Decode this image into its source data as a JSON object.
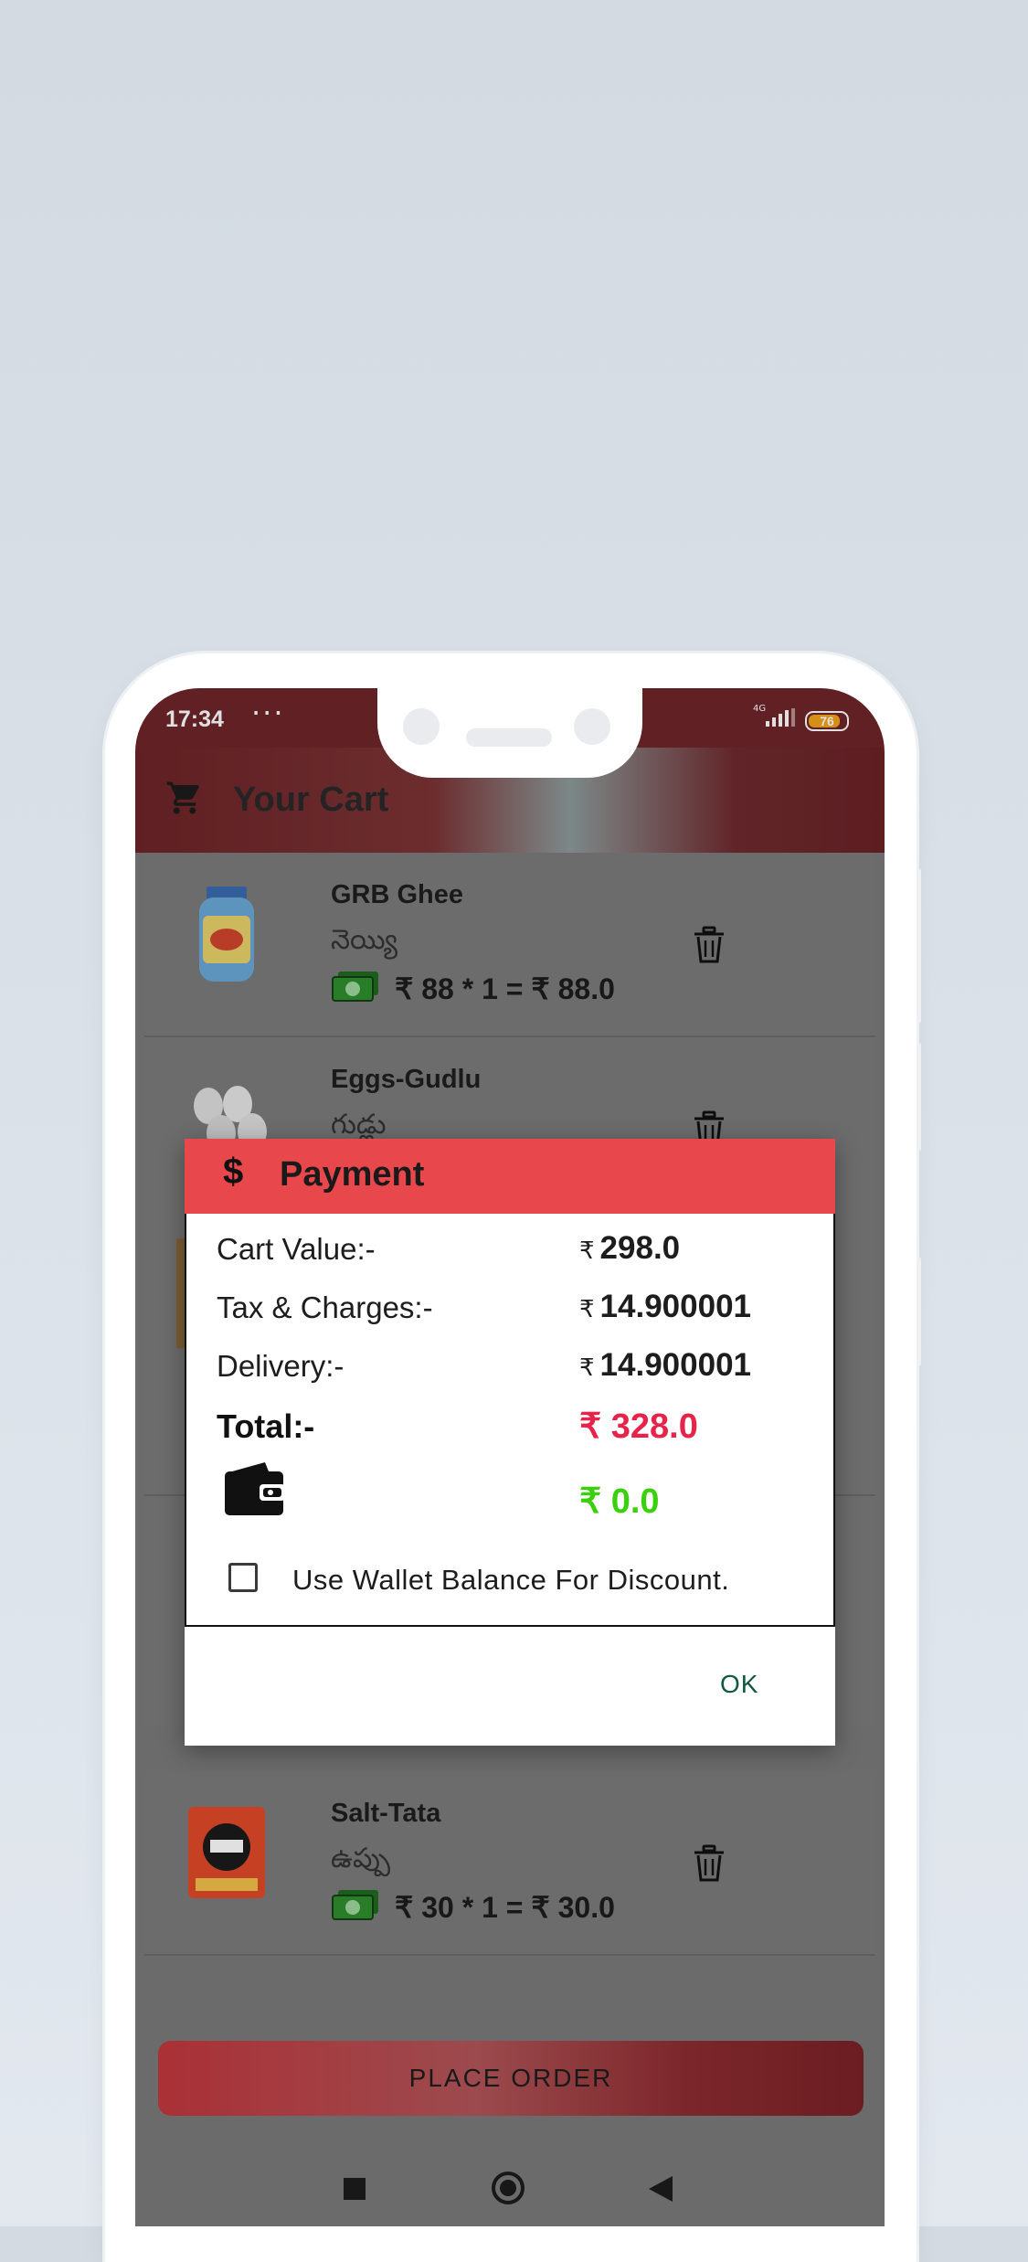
{
  "status_bar": {
    "time": "17:34",
    "dots": "···",
    "network": "4G",
    "battery": "76"
  },
  "app_bar": {
    "title": "Your Cart",
    "icon": "cart-icon"
  },
  "cart_items": [
    {
      "name": "GRB Ghee",
      "local_name": "నెయ్యి",
      "price_line": "₹ 88 * 1 = ₹ 88.0"
    },
    {
      "name": "Eggs-Gudlu",
      "local_name": "గుడ్లు",
      "price_line": ""
    },
    {
      "name": "Salt-Tata",
      "local_name": "ఉప్పు",
      "price_line": "₹ 30 * 1 = ₹ 30.0"
    }
  ],
  "place_order_label": "PLACE ORDER",
  "payment_dialog": {
    "dollar_symbol": "$",
    "title": "Payment",
    "rupee_symbol": "₹",
    "cart_value_label": "Cart Value:-",
    "cart_value": "298.0",
    "tax_label": "Tax & Charges:-",
    "tax_value": "14.900001",
    "delivery_label": "Delivery:-",
    "delivery_value": "14.900001",
    "total_label": "Total:-",
    "total_value": "₹ 328.0",
    "wallet_value": "₹ 0.0",
    "wallet_checkbox_label": "Use Wallet Balance For Discount.",
    "ok_label": "OK"
  },
  "colors": {
    "dialog_header": "#e8474b",
    "total": "#e8234a",
    "wallet": "#3ad10c",
    "ok": "#0e5a3a",
    "app_bar": "#6d2428"
  }
}
